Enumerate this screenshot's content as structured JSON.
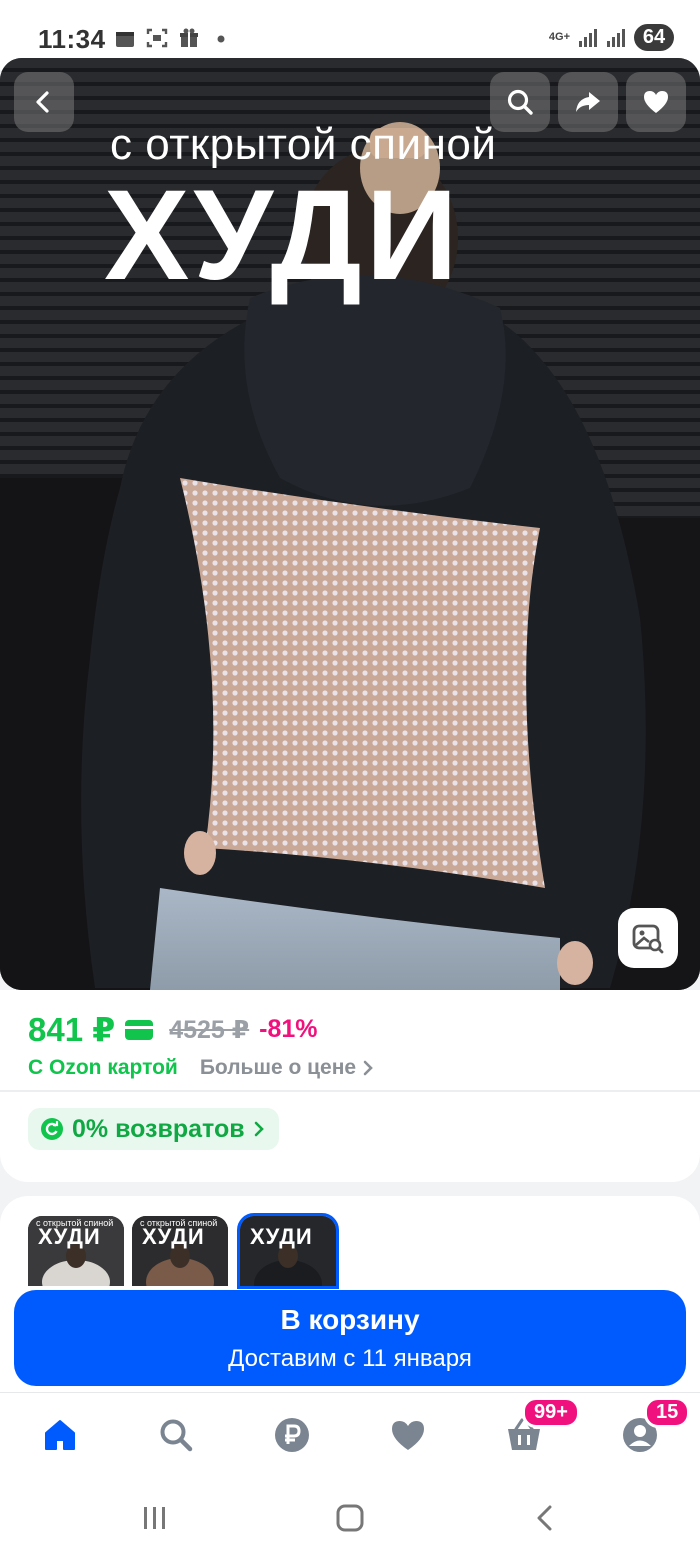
{
  "status_bar": {
    "time": "11:34",
    "left_icons": [
      "calendar-icon",
      "screenshot-icon",
      "gift-icon",
      "dot-icon"
    ],
    "network": "4G+",
    "battery": "64"
  },
  "hero": {
    "caption_small": "с открытой спиной",
    "caption_big": "ХУДИ",
    "buttons": [
      "back-icon",
      "search-icon",
      "share-icon",
      "heart-icon"
    ],
    "lens_icon": "image-search-icon"
  },
  "price": {
    "current": "841 ₽",
    "old": "4525 ₽",
    "discount": "-81%",
    "ozon_card_label": "С Ozon картой",
    "more_about_price": "Больше о цене",
    "returns": "0% возвратов",
    "accent_green": "#10c44c",
    "accent_pink": "#f1117e"
  },
  "thumbnails": [
    {
      "small": "с открытой спиной",
      "big": "ХУДИ",
      "active": false
    },
    {
      "small": "с открытой спиной",
      "big": "ХУДИ",
      "active": false
    },
    {
      "small": "",
      "big": "ХУДИ",
      "active": true
    }
  ],
  "cart": {
    "title": "В корзину",
    "subtitle": "Доставим с 11 января",
    "color": "#005bff"
  },
  "bottom_nav": {
    "items": [
      "home-icon",
      "search-icon",
      "ruble-icon",
      "heart-icon",
      "basket-icon",
      "profile-icon"
    ],
    "cart_badge": "99+",
    "profile_badge": "15"
  },
  "system_nav": [
    "recents-icon",
    "home-icon",
    "back-icon"
  ]
}
